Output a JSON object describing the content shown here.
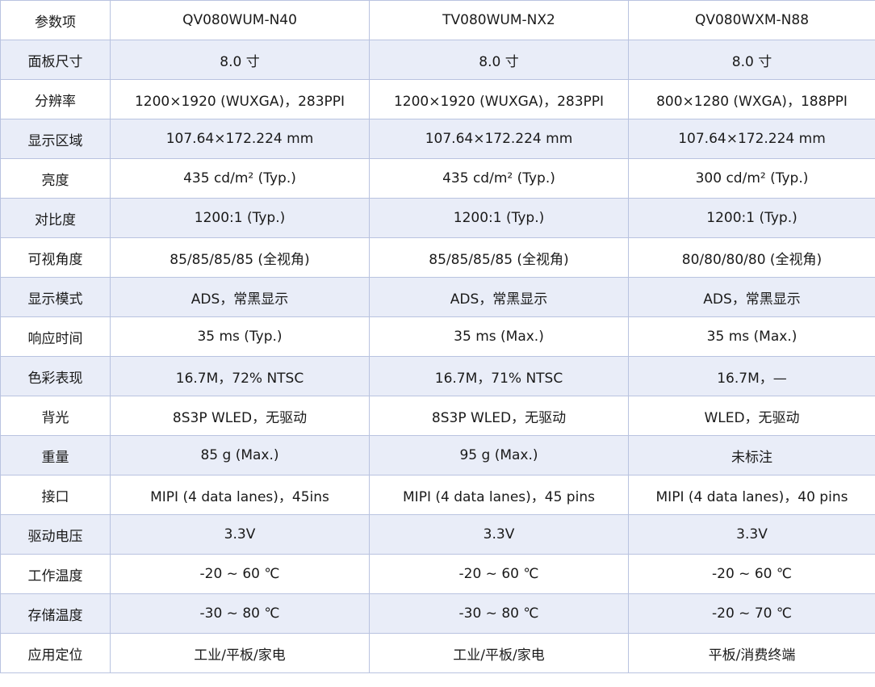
{
  "table": {
    "headers": [
      "参数项",
      "QV080WUM-N40",
      "TV080WUM-NX2",
      "QV080WXM-N88"
    ],
    "rows": [
      [
        "面板尺寸",
        "8.0 寸",
        "8.0 寸",
        "8.0 寸"
      ],
      [
        "分辨率",
        "1200×1920 (WUXGA)，283PPI",
        "1200×1920 (WUXGA)，283PPI",
        "800×1280 (WXGA)，188PPI"
      ],
      [
        "显示区域",
        "107.64×172.224 mm",
        "107.64×172.224 mm",
        "107.64×172.224 mm"
      ],
      [
        "亮度",
        "435 cd/m² (Typ.)",
        "435 cd/m² (Typ.)",
        "300 cd/m² (Typ.)"
      ],
      [
        "对比度",
        "1200:1 (Typ.)",
        "1200:1 (Typ.)",
        "1200:1 (Typ.)"
      ],
      [
        "可视角度",
        "85/85/85/85 (全视角)",
        "85/85/85/85 (全视角)",
        "80/80/80/80 (全视角)"
      ],
      [
        "显示模式",
        "ADS，常黑显示",
        "ADS，常黑显示",
        "ADS，常黑显示"
      ],
      [
        "响应时间",
        "35 ms (Typ.)",
        "35 ms (Max.)",
        "35 ms (Max.)"
      ],
      [
        "色彩表现",
        "16.7M，72% NTSC",
        "16.7M，71% NTSC",
        "16.7M，—"
      ],
      [
        "背光",
        "8S3P WLED，无驱动",
        "8S3P WLED，无驱动",
        "WLED，无驱动"
      ],
      [
        "重量",
        "85 g (Max.)",
        "95 g (Max.)",
        "未标注"
      ],
      [
        "接口",
        "MIPI (4 data lanes)，45ins",
        "MIPI (4 data lanes)，45 pins",
        "MIPI (4 data lanes)，40 pins"
      ],
      [
        "驱动电压",
        "3.3V",
        "3.3V",
        "3.3V"
      ],
      [
        "工作温度",
        "-20 ~ 60 ℃",
        "-20 ~ 60 ℃",
        "-20 ~ 60 ℃"
      ],
      [
        "存储温度",
        "-30 ~ 80 ℃",
        "-30 ~ 80 ℃",
        "-20 ~ 70 ℃"
      ],
      [
        "应用定位",
        "工业/平板/家电",
        "工业/平板/家电",
        "平板/消费终端"
      ]
    ]
  },
  "colors": {
    "border": "#b9c3e0",
    "alt_row_bg": "#e9edf8",
    "text": "#1a1a1a"
  }
}
